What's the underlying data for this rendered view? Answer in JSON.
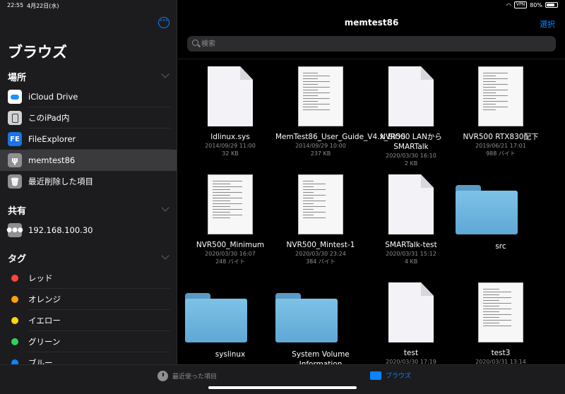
{
  "status_bar": {
    "time": "22:55",
    "date": "4月22日(水)",
    "vpn": "VPN",
    "battery": "80%",
    "battery_level": 0.8
  },
  "sidebar": {
    "title": "ブラウズ",
    "locations_header": "場所",
    "locations": [
      {
        "label": "iCloud Drive",
        "icon": "icloud-icon"
      },
      {
        "label": "このiPad内",
        "icon": "ipad-icon"
      },
      {
        "label": "FileExplorer",
        "icon": "fileexplorer-icon",
        "glyph": "FE"
      },
      {
        "label": "memtest86",
        "icon": "usb-icon",
        "glyph": "ψ",
        "selected": true
      },
      {
        "label": "最近削除した項目",
        "icon": "trash-icon",
        "glyph": "🗑"
      }
    ],
    "shared_header": "共有",
    "shared": [
      {
        "label": "192.168.100.30",
        "icon": "network-server-icon",
        "glyph": "●●●"
      }
    ],
    "tags_header": "タグ",
    "tags": [
      {
        "label": "レッド",
        "color": "#ff453a"
      },
      {
        "label": "オレンジ",
        "color": "#ff9f0a"
      },
      {
        "label": "イエロー",
        "color": "#ffd60a"
      },
      {
        "label": "グリーン",
        "color": "#30d158"
      },
      {
        "label": "ブルー",
        "color": "#0a84ff"
      }
    ]
  },
  "main": {
    "title": "memtest86",
    "select_label": "選択",
    "search_placeholder": "検索",
    "items": [
      {
        "name": "ldlinux.sys",
        "date": "2014/09/29 11:00",
        "size": "32 KB",
        "kind": "doc"
      },
      {
        "name": "MemTest86_User_Guide_V4.x_BIOS",
        "date": "2014/09/29 10:00",
        "size": "237 KB",
        "kind": "page"
      },
      {
        "name": "NVR500 LANからSMARTalk",
        "date": "2020/03/30 16:10",
        "size": "2 KB",
        "kind": "doc"
      },
      {
        "name": "NVR500 RTX830配下",
        "date": "2019/06/21 17:01",
        "size": "988 バイト",
        "kind": "page"
      },
      {
        "name": "NVR500_Minimum",
        "date": "2020/03/30 16:07",
        "size": "248 バイト",
        "kind": "page"
      },
      {
        "name": "NVR500_Mintest-1",
        "date": "2020/03/30 23:24",
        "size": "384 バイト",
        "kind": "page"
      },
      {
        "name": "SMARTalk-test",
        "date": "2020/03/31 15:12",
        "size": "4 KB",
        "kind": "doc"
      },
      {
        "name": "src",
        "date": "",
        "size": "",
        "kind": "folder"
      },
      {
        "name": "syslinux",
        "date": "",
        "size": "",
        "kind": "folder"
      },
      {
        "name": "System Volume Information",
        "date": "",
        "size": "",
        "kind": "folder"
      },
      {
        "name": "test",
        "date": "2020/03/30 17:19",
        "size": "",
        "kind": "doc"
      },
      {
        "name": "test3",
        "date": "2020/03/31 13:14",
        "size": "",
        "kind": "page"
      }
    ]
  },
  "tab_bar": {
    "recent_label": "最近使った項目",
    "browse_label": "ブラウズ"
  },
  "colors": {
    "accent": "#0a84ff",
    "folder": "#6cb4de"
  }
}
